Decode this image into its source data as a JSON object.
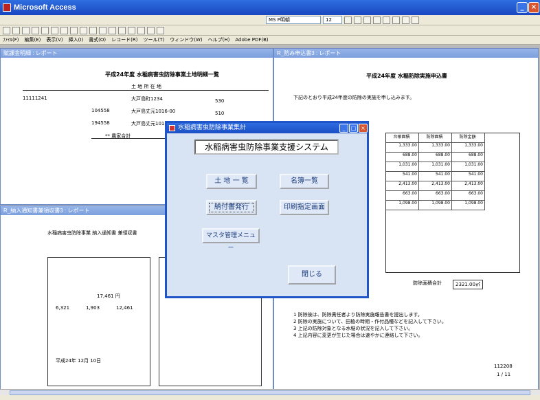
{
  "app": {
    "title": "Microsoft Access"
  },
  "toolbar": {
    "font_name": "MS P明朝",
    "font_size": "12"
  },
  "menu": [
    "ﾌｧｲﾙ(F)",
    "編集(E)",
    "表示(V)",
    "挿入(I)",
    "書式(O)",
    "レコード(R)",
    "ツール(T)",
    "ウィンドウ(W)",
    "ヘルプ(H)",
    "Adobe PDF(B)"
  ],
  "windows": {
    "left_top": {
      "title": "賦課金明細 : レポート",
      "heading": "平成24年度 水稲病害虫防除事業土地明細一覧",
      "col_land": "土 地 所 在 地",
      "row1_no": "11111241",
      "row1_addr1": "大戸島町1234",
      "row1_addr2": "大戸島丈元1016-00",
      "row1_addr3": "大戸島丈元1018-40",
      "row1_code1": "104558",
      "row1_code2": "194558",
      "row1_v1": "530",
      "row1_v2": "510",
      "row1_v3": "510",
      "total_label": "** 農家合計"
    },
    "right": {
      "title": "R_防み申込書3 : レポート",
      "heading": "平成24年度  水稲防除実施申込書",
      "intro": "下記のとおり平成24年度の防除の実施を申し込みます。",
      "col_area": "台帳面積",
      "col_actual": "防除面積",
      "col_amount": "防除金額",
      "rows": [
        [
          "1,333.00",
          "1,333.00",
          "1,333.00"
        ],
        [
          "688.00",
          "688.00",
          "688.00"
        ],
        [
          "1,031.00",
          "1,031.00",
          "1,031.00"
        ],
        [
          "541.00",
          "541.00",
          "541.00"
        ],
        [
          "2,413.00",
          "2,413.00",
          "2,413.00"
        ],
        [
          "663.00",
          "663.00",
          "663.00"
        ],
        [
          "1,098.00",
          "1,098.00",
          "1,098.00"
        ]
      ],
      "total_label": "防除面積合計",
      "total_value": "2321.00㎡",
      "notes": [
        "1 防除後は、防除責任者より防除実施報告書を提出します。",
        "2 防除の実施について、田植の時期・作付品種などを記入して下さい。",
        "3 上記の防除対象となる水稲の状況を記入して下さい。",
        "4 上記内容に変更が生じた場合は速やかに連絡して下さい。"
      ],
      "footer_no": "112208",
      "footer_page": "1 / 11"
    },
    "left_bottom": {
      "title": "R_納入通知書兼領収書3 : レポート",
      "heading": "水稲病害虫防除事業 納入通知書 兼領収書",
      "amount": "17,461 円",
      "date": "平成24年 12月 10日",
      "amount_cells": [
        "6,321",
        "1,903",
        "12,461"
      ]
    }
  },
  "dialog": {
    "title": "水稲病害虫防除事業集計",
    "system_name": "水稲病害虫防除事業支援システム",
    "btn_land_list": "土 地 一 覧",
    "btn_roster": "名簿一覧",
    "btn_notice": "納付書発行",
    "btn_print_settings": "印刷指定画面",
    "btn_master": "マスタ管理メニュー",
    "btn_close": "閉じる"
  }
}
